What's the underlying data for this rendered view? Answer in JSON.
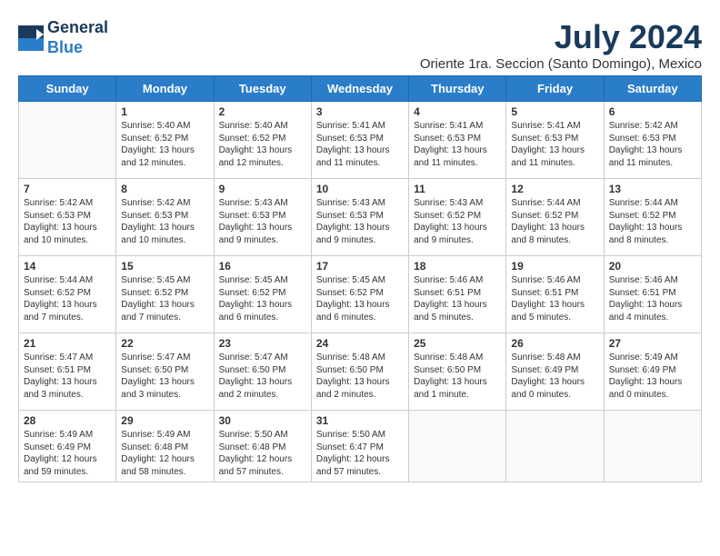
{
  "header": {
    "logo_line1": "General",
    "logo_line2": "Blue",
    "month_title": "July 2024",
    "location": "Oriente 1ra. Seccion (Santo Domingo), Mexico"
  },
  "weekdays": [
    "Sunday",
    "Monday",
    "Tuesday",
    "Wednesday",
    "Thursday",
    "Friday",
    "Saturday"
  ],
  "weeks": [
    [
      {
        "day": "",
        "content": ""
      },
      {
        "day": "1",
        "content": "Sunrise: 5:40 AM\nSunset: 6:52 PM\nDaylight: 13 hours\nand 12 minutes."
      },
      {
        "day": "2",
        "content": "Sunrise: 5:40 AM\nSunset: 6:52 PM\nDaylight: 13 hours\nand 12 minutes."
      },
      {
        "day": "3",
        "content": "Sunrise: 5:41 AM\nSunset: 6:53 PM\nDaylight: 13 hours\nand 11 minutes."
      },
      {
        "day": "4",
        "content": "Sunrise: 5:41 AM\nSunset: 6:53 PM\nDaylight: 13 hours\nand 11 minutes."
      },
      {
        "day": "5",
        "content": "Sunrise: 5:41 AM\nSunset: 6:53 PM\nDaylight: 13 hours\nand 11 minutes."
      },
      {
        "day": "6",
        "content": "Sunrise: 5:42 AM\nSunset: 6:53 PM\nDaylight: 13 hours\nand 11 minutes."
      }
    ],
    [
      {
        "day": "7",
        "content": "Sunrise: 5:42 AM\nSunset: 6:53 PM\nDaylight: 13 hours\nand 10 minutes."
      },
      {
        "day": "8",
        "content": "Sunrise: 5:42 AM\nSunset: 6:53 PM\nDaylight: 13 hours\nand 10 minutes."
      },
      {
        "day": "9",
        "content": "Sunrise: 5:43 AM\nSunset: 6:53 PM\nDaylight: 13 hours\nand 9 minutes."
      },
      {
        "day": "10",
        "content": "Sunrise: 5:43 AM\nSunset: 6:53 PM\nDaylight: 13 hours\nand 9 minutes."
      },
      {
        "day": "11",
        "content": "Sunrise: 5:43 AM\nSunset: 6:52 PM\nDaylight: 13 hours\nand 9 minutes."
      },
      {
        "day": "12",
        "content": "Sunrise: 5:44 AM\nSunset: 6:52 PM\nDaylight: 13 hours\nand 8 minutes."
      },
      {
        "day": "13",
        "content": "Sunrise: 5:44 AM\nSunset: 6:52 PM\nDaylight: 13 hours\nand 8 minutes."
      }
    ],
    [
      {
        "day": "14",
        "content": "Sunrise: 5:44 AM\nSunset: 6:52 PM\nDaylight: 13 hours\nand 7 minutes."
      },
      {
        "day": "15",
        "content": "Sunrise: 5:45 AM\nSunset: 6:52 PM\nDaylight: 13 hours\nand 7 minutes."
      },
      {
        "day": "16",
        "content": "Sunrise: 5:45 AM\nSunset: 6:52 PM\nDaylight: 13 hours\nand 6 minutes."
      },
      {
        "day": "17",
        "content": "Sunrise: 5:45 AM\nSunset: 6:52 PM\nDaylight: 13 hours\nand 6 minutes."
      },
      {
        "day": "18",
        "content": "Sunrise: 5:46 AM\nSunset: 6:51 PM\nDaylight: 13 hours\nand 5 minutes."
      },
      {
        "day": "19",
        "content": "Sunrise: 5:46 AM\nSunset: 6:51 PM\nDaylight: 13 hours\nand 5 minutes."
      },
      {
        "day": "20",
        "content": "Sunrise: 5:46 AM\nSunset: 6:51 PM\nDaylight: 13 hours\nand 4 minutes."
      }
    ],
    [
      {
        "day": "21",
        "content": "Sunrise: 5:47 AM\nSunset: 6:51 PM\nDaylight: 13 hours\nand 3 minutes."
      },
      {
        "day": "22",
        "content": "Sunrise: 5:47 AM\nSunset: 6:50 PM\nDaylight: 13 hours\nand 3 minutes."
      },
      {
        "day": "23",
        "content": "Sunrise: 5:47 AM\nSunset: 6:50 PM\nDaylight: 13 hours\nand 2 minutes."
      },
      {
        "day": "24",
        "content": "Sunrise: 5:48 AM\nSunset: 6:50 PM\nDaylight: 13 hours\nand 2 minutes."
      },
      {
        "day": "25",
        "content": "Sunrise: 5:48 AM\nSunset: 6:50 PM\nDaylight: 13 hours\nand 1 minute."
      },
      {
        "day": "26",
        "content": "Sunrise: 5:48 AM\nSunset: 6:49 PM\nDaylight: 13 hours\nand 0 minutes."
      },
      {
        "day": "27",
        "content": "Sunrise: 5:49 AM\nSunset: 6:49 PM\nDaylight: 13 hours\nand 0 minutes."
      }
    ],
    [
      {
        "day": "28",
        "content": "Sunrise: 5:49 AM\nSunset: 6:49 PM\nDaylight: 12 hours\nand 59 minutes."
      },
      {
        "day": "29",
        "content": "Sunrise: 5:49 AM\nSunset: 6:48 PM\nDaylight: 12 hours\nand 58 minutes."
      },
      {
        "day": "30",
        "content": "Sunrise: 5:50 AM\nSunset: 6:48 PM\nDaylight: 12 hours\nand 57 minutes."
      },
      {
        "day": "31",
        "content": "Sunrise: 5:50 AM\nSunset: 6:47 PM\nDaylight: 12 hours\nand 57 minutes."
      },
      {
        "day": "",
        "content": ""
      },
      {
        "day": "",
        "content": ""
      },
      {
        "day": "",
        "content": ""
      }
    ]
  ]
}
